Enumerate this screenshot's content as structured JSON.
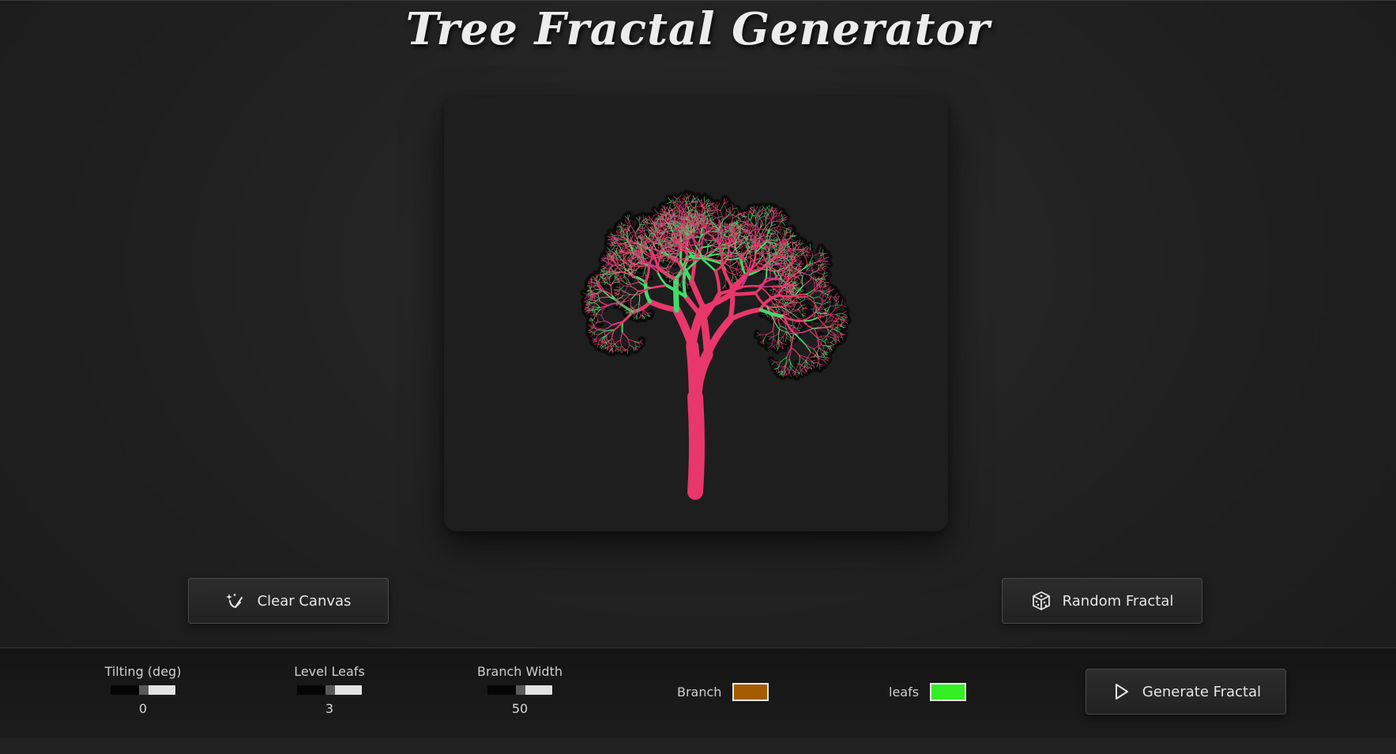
{
  "header": {
    "title": "Tree Fractal Generator"
  },
  "actions": {
    "clear_label": "Clear Canvas",
    "clear_icon": "brush-sparkle-icon",
    "random_label": "Random Fractal",
    "random_icon": "dice-icon"
  },
  "controls": {
    "tilting": {
      "label": "Tilting (deg)",
      "value": "0"
    },
    "level_leafs": {
      "label": "Level Leafs",
      "value": "3"
    },
    "branch_width": {
      "label": "Branch Width",
      "value": "50"
    },
    "branch_color": {
      "label": "Branch",
      "color": "#a35c00"
    },
    "leafs_color": {
      "label": "leafs",
      "color": "#33ee22"
    },
    "generate_label": "Generate Fractal",
    "generate_icon": "play-icon"
  },
  "canvas": {
    "trunk_color": "#e8376b",
    "leaf_color": "#3fdc6a",
    "accent_color": "#b43a8a"
  }
}
